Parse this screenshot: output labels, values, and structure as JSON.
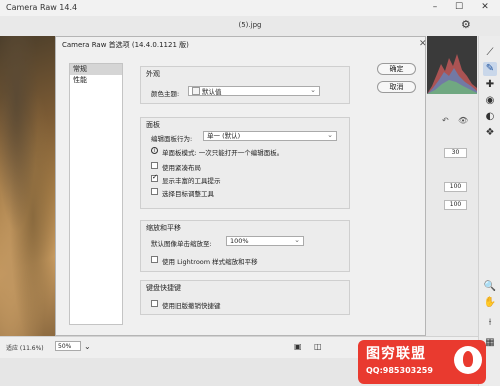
{
  "window": {
    "title": "Camera Raw 14.4"
  },
  "toolbar": {
    "file_name": "(5).jpg"
  },
  "dialog": {
    "title": "Camera Raw 首选项 (14.4.0.1121 版)",
    "nav": [
      "常规",
      "性能"
    ],
    "buttons": {
      "ok": "确定",
      "cancel": "取消"
    },
    "appearance": {
      "title": "外观",
      "color_theme_label": "颜色主题:",
      "color_theme_value": "默认值"
    },
    "panels": {
      "title": "面板",
      "behavior_label": "编辑面板行为:",
      "behavior_value": "单一 (默认)",
      "mode_info": "单面板模式: 一次只能打开一个编辑面板。",
      "options": [
        {
          "label": "使用紧凑布局",
          "checked": false
        },
        {
          "label": "显示丰富的工具提示",
          "checked": true
        },
        {
          "label": "选择目标调整工具",
          "checked": false
        }
      ]
    },
    "zoom": {
      "title": "缩放和平移",
      "default_zoom_label": "默认图像单击缩放至:",
      "default_zoom_value": "100%",
      "lightroom_option": "使用 Lightroom 样式缩放和平移"
    },
    "shortcuts": {
      "title": "键盘快捷键",
      "legacy_option": "使用旧版撤销快捷键"
    }
  },
  "side_panel": {
    "values": [
      "30",
      "100",
      "100"
    ]
  },
  "statusbar": {
    "fit_label": "适应 (11.6%)",
    "zoom_value": "50%"
  },
  "watermark": {
    "title": "图穷联盟",
    "qq": "QQ:985303259"
  },
  "icons": {
    "tools": [
      "crop-icon",
      "brush-icon",
      "heal-icon",
      "redeye-icon",
      "mask-icon",
      "presets-icon",
      "zoom-icon",
      "hand-icon",
      "eyedropper-icon",
      "grid-icon"
    ]
  }
}
